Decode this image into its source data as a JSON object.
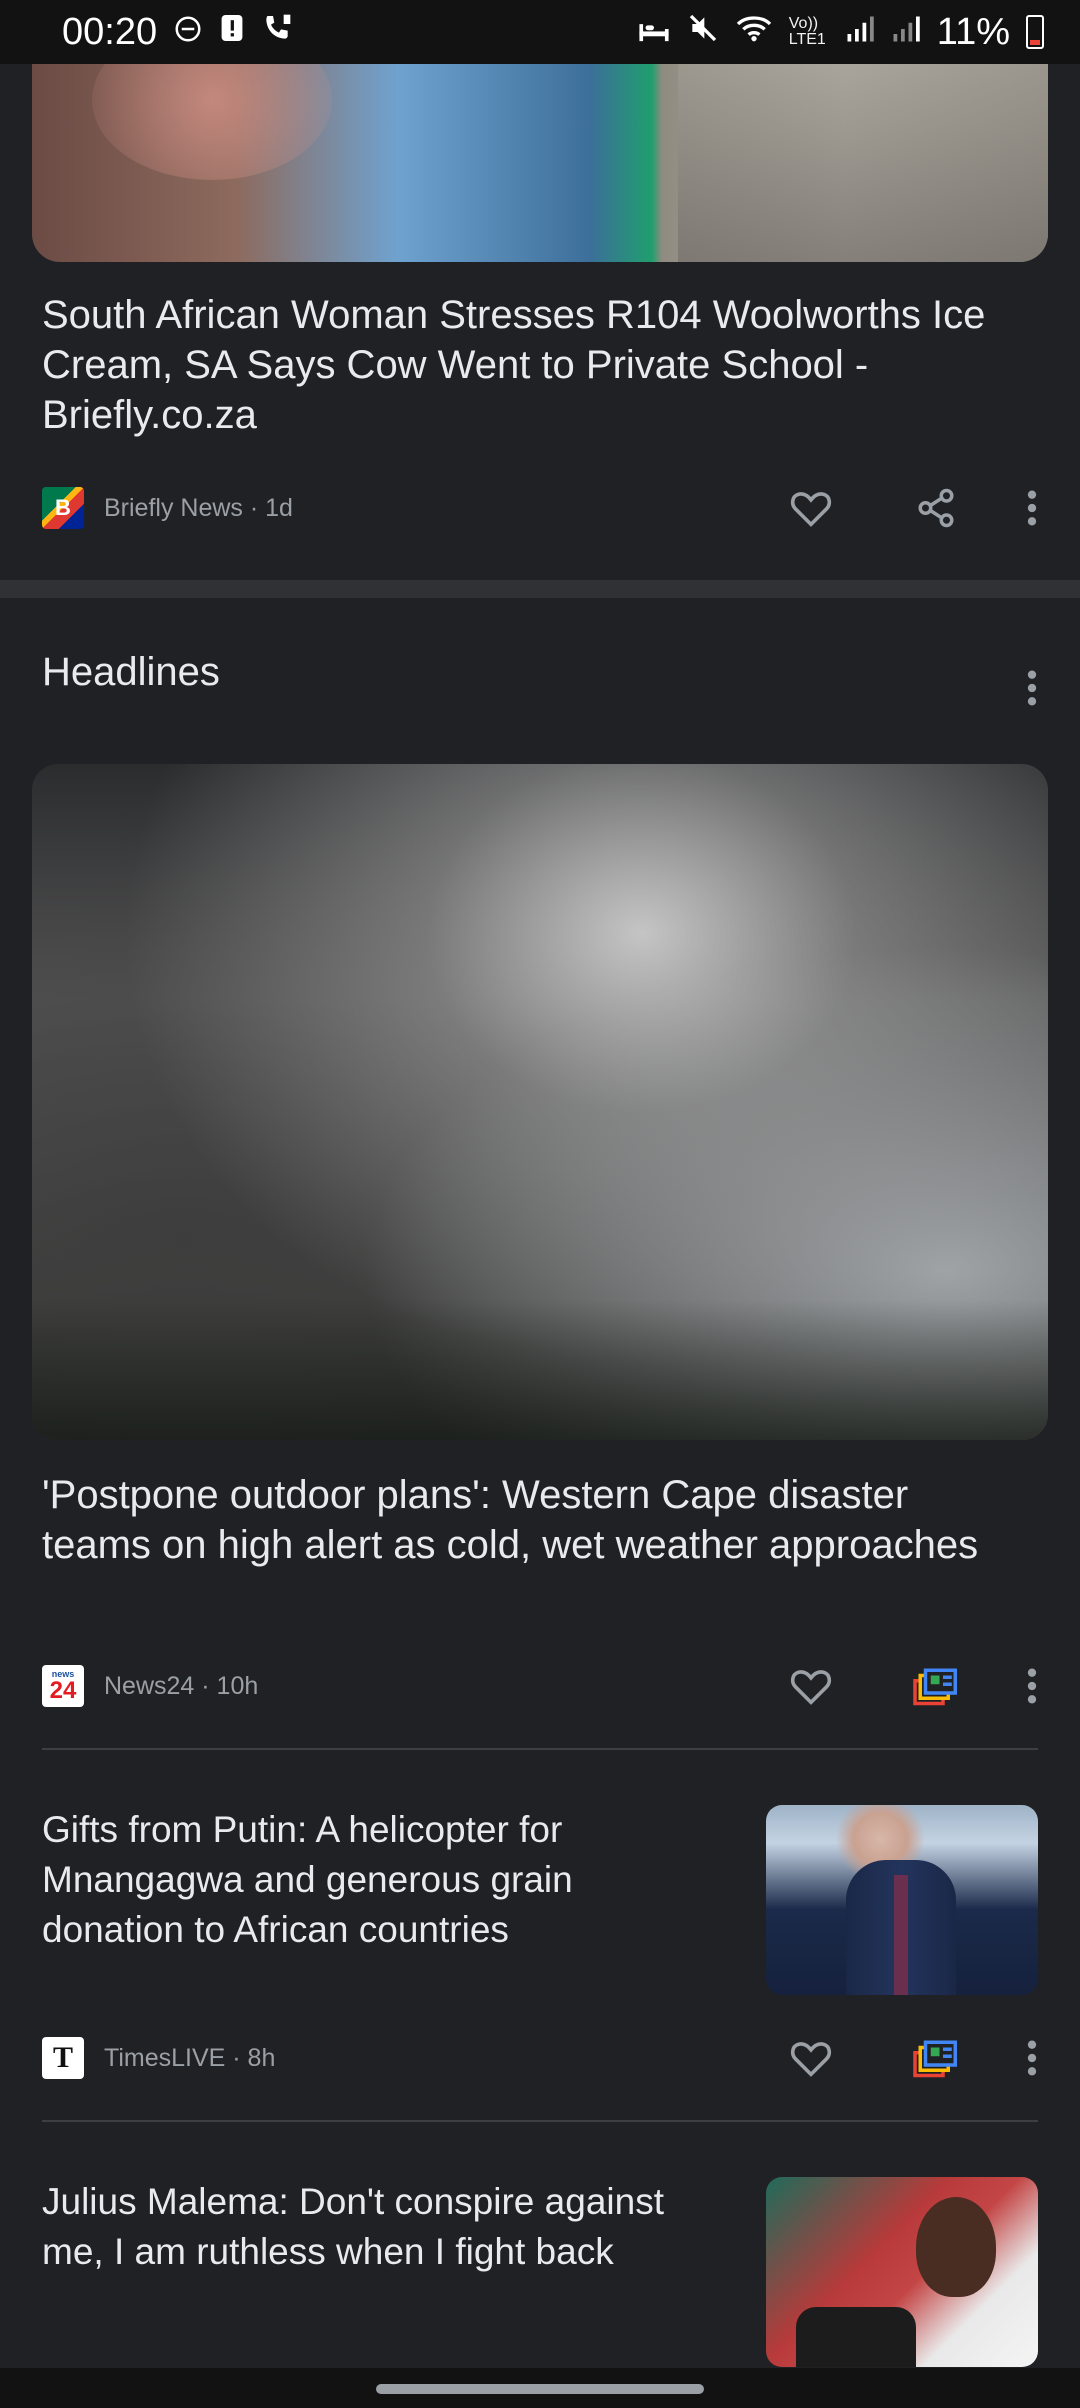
{
  "status_bar": {
    "time": "00:20",
    "battery_text": "11%",
    "network_label": "Vo)) LTE1"
  },
  "article1": {
    "title": "South African Woman Stresses R104 Woolworths Ice Cream, SA Says Cow Went to Private School - Briefly.co.za",
    "source": "Briefly News · 1d",
    "logo_text": "B"
  },
  "headlines": {
    "section_title": "Headlines",
    "items": [
      {
        "title": "'Postpone outdoor plans': Western Cape disaster teams on high alert as cold, wet weather approaches",
        "source": "News24 · 10h",
        "logo_text": "24"
      },
      {
        "title": "Gifts from Putin: A helicopter for Mnangagwa and generous grain donation to African countries",
        "source": "TimesLIVE · 8h",
        "logo_text": "T"
      },
      {
        "title": "Julius Malema: Don't conspire against me, I am ruthless when I fight back"
      }
    ]
  },
  "colors": {
    "background": "#202124",
    "text": "#e8eaed",
    "secondary": "#9aa0a6"
  }
}
